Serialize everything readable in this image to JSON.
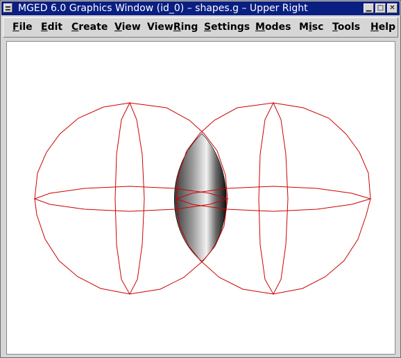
{
  "window": {
    "title": "MGED 6.0 Graphics Window (id_0) – shapes.g – Upper Right",
    "minimize_glyph": "▁",
    "maximize_glyph": "□",
    "close_glyph": "✕"
  },
  "menu": {
    "items": [
      {
        "accel": "F",
        "rest": "ile"
      },
      {
        "accel": "E",
        "rest": "dit"
      },
      {
        "accel": "C",
        "rest": "reate"
      },
      {
        "accel": "V",
        "rest": "iew"
      },
      {
        "pre": "View",
        "accel": "R",
        "rest": "ing"
      },
      {
        "accel": "S",
        "rest": "ettings"
      },
      {
        "accel": "M",
        "rest": "odes"
      },
      {
        "pre": "M",
        "accel": "i",
        "rest": "sc"
      },
      {
        "accel": "T",
        "rest": "ools"
      },
      {
        "accel": "H",
        "rest": "elp"
      }
    ]
  },
  "scene": {
    "wireframe_color": "#cc0000",
    "shaded_object": "sphere-intersection-lens"
  }
}
